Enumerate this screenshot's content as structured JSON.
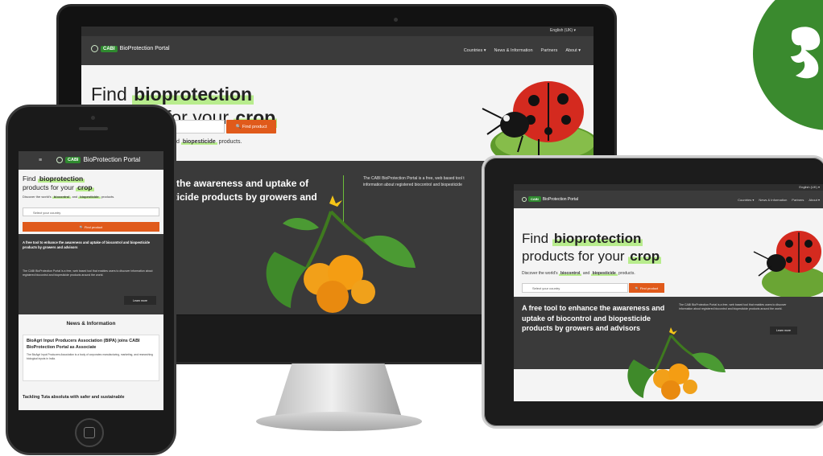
{
  "brand": {
    "cabi": "CABI",
    "portal_name": "BioProtection Portal",
    "language": "English (UK)",
    "accent_color": "#2f8a2f",
    "cta_color": "#e05a1b",
    "highlight_color": "#b8ec8d"
  },
  "desktop": {
    "nav": [
      "Countries",
      "News & Information",
      "Partners",
      "About"
    ],
    "hero_word_find": "Find",
    "hero_word_bio": "bioprotection",
    "hero_word_for": "for your",
    "hero_word_crop": "crop",
    "sub_fragment_ol": "ol",
    "sub_and": "and",
    "sub_biopesticide": "biopesticide",
    "sub_products": "products.",
    "find_button": "Find product",
    "tagline_partial": "e the awareness and uptake of sticide products by growers and",
    "description_partial": "The CABI BioProtection Portal is a free, web based tool t information about registered biocontrol and biopesticide"
  },
  "tablet": {
    "nav": [
      "Countries",
      "News & Information",
      "Partners",
      "About"
    ],
    "hero_line1_find": "Find",
    "hero_line1_bio": "bioprotection",
    "hero_line2_products": "products for your",
    "hero_line2_crop": "crop",
    "sub_discover": "Discover the world's",
    "sub_biocontrol": "biocontrol",
    "sub_and": "and",
    "sub_biopesticide": "biopesticide",
    "sub_products": "products.",
    "select_placeholder": "Select your country",
    "find_button": "Find product",
    "tagline": "A free tool to enhance the awareness and uptake of biocontrol and biopesticide products by growers and advisors",
    "description": "The CABI BioProtection Portal is a free, web based tool that enables users to discover information about registered biocontrol and biopesticide products around the world.",
    "learn_more": "Learn more"
  },
  "phone": {
    "hero_line1_find": "Find",
    "hero_line1_bio": "bioprotection",
    "hero_line2_products": "products for your",
    "hero_line2_crop": "crop",
    "sub_discover": "Discover the world's",
    "sub_biocontrol": "biocontrol",
    "sub_and": "and",
    "sub_biopesticide": "biopesticide",
    "sub_products": "products.",
    "select_placeholder": "Select your country",
    "find_button": "Find product",
    "tagline": "A free tool to enhance the awareness and uptake of biocontrol and biopesticide products by growers and advisors",
    "description": "The CABI BioProtection Portal is a free, web based tool that enables users to discover information about registered biocontrol and biopesticide products around the world.",
    "learn_more": "Learn more",
    "news_heading": "News & Information",
    "news1_title": "BioAgri Input Producers Association (BIPA) joins CABI BioProtection Portal as Associate",
    "news1_body": "The BioAgri Input Producers Association is a body of corporates manufacturing, marketing, and researching biological inputs in India.",
    "news2_title": "Tackling Tuta absoluta with safer and sustainable"
  }
}
